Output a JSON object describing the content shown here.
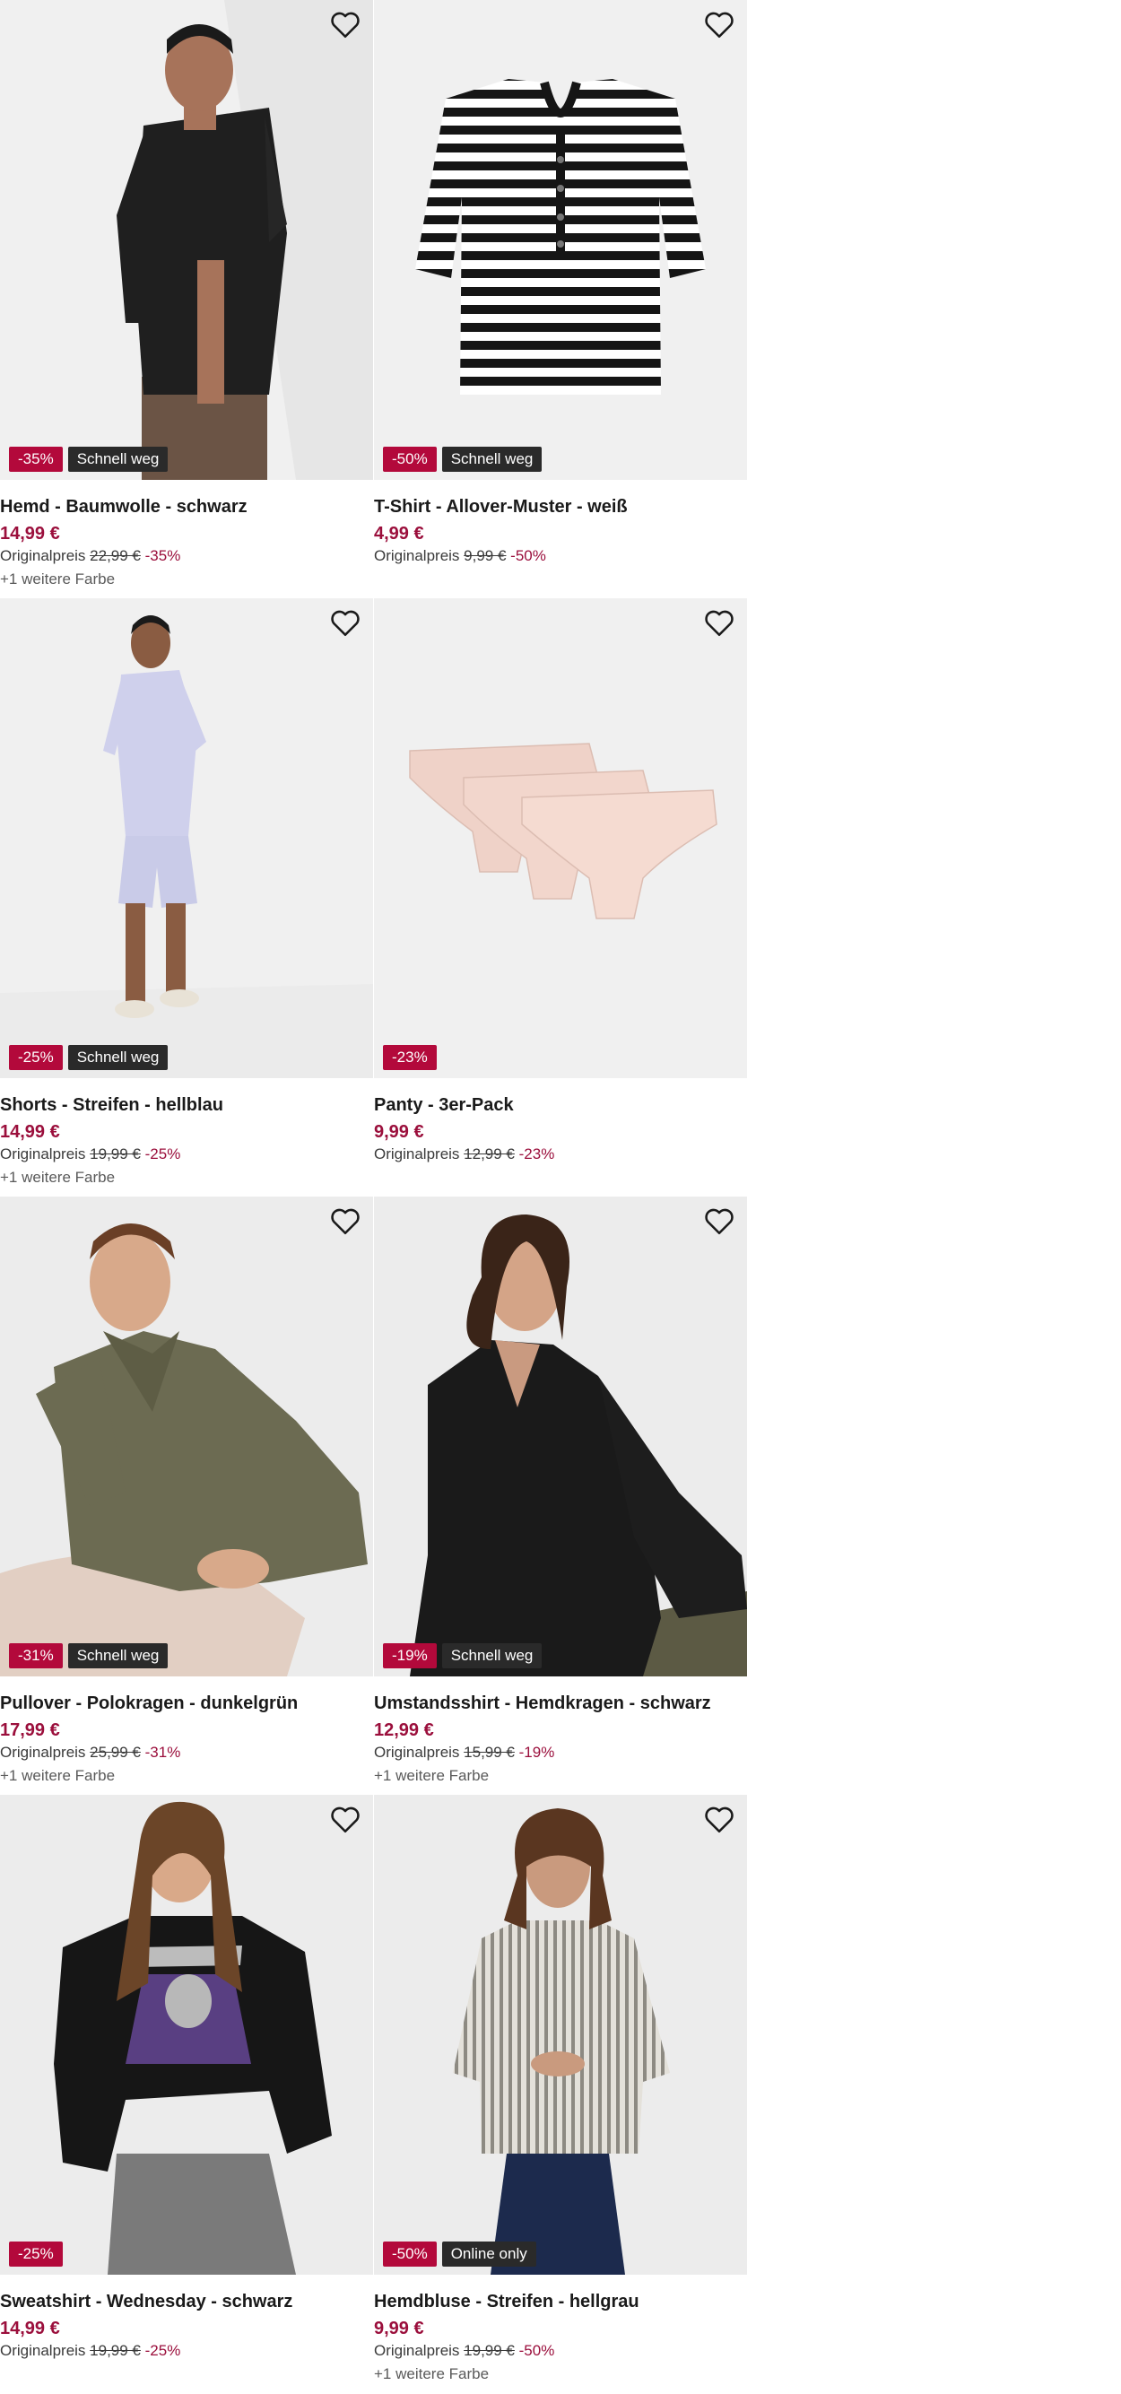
{
  "colors": {
    "price": "#9b0f3c",
    "discount_badge": "#b3093b",
    "tag_badge": "#2a2a2a",
    "image_bg": "#f0f0f0"
  },
  "products": [
    {
      "title": "Hemd - Baumwolle - schwarz",
      "price": "14,99 €",
      "original_label": "Originalpreis",
      "original_price": "22,99 €",
      "discount_text": "-35%",
      "badge_discount": "-35%",
      "badge_tag": "Schnell weg",
      "more_colors": "+1 weitere Farbe",
      "image": "man-black-shirt"
    },
    {
      "title": "T-Shirt - Allover-Muster - weiß",
      "price": "4,99 €",
      "original_label": "Originalpreis",
      "original_price": "9,99 €",
      "discount_text": "-50%",
      "badge_discount": "-50%",
      "badge_tag": "Schnell weg",
      "more_colors": "",
      "image": "striped-tshirt"
    },
    {
      "title": "Shorts - Streifen - hellblau",
      "price": "14,99 €",
      "original_label": "Originalpreis",
      "original_price": "19,99 €",
      "discount_text": "-25%",
      "badge_discount": "-25%",
      "badge_tag": "Schnell weg",
      "more_colors": "+1 weitere Farbe",
      "image": "man-light-blue-set"
    },
    {
      "title": "Panty - 3er-Pack",
      "price": "9,99 €",
      "original_label": "Originalpreis",
      "original_price": "12,99 €",
      "discount_text": "-23%",
      "badge_discount": "-23%",
      "badge_tag": "",
      "more_colors": "",
      "image": "pink-panties"
    },
    {
      "title": "Pullover - Polokragen - dunkelgrün",
      "price": "17,99 €",
      "original_label": "Originalpreis",
      "original_price": "25,99 €",
      "discount_text": "-31%",
      "badge_discount": "-31%",
      "badge_tag": "Schnell weg",
      "more_colors": "+1 weitere Farbe",
      "image": "man-green-pullover"
    },
    {
      "title": "Umstandsshirt - Hemdkragen - schwarz",
      "price": "12,99 €",
      "original_label": "Originalpreis",
      "original_price": "15,99 €",
      "discount_text": "-19%",
      "badge_discount": "-19%",
      "badge_tag": "Schnell weg",
      "more_colors": "+1 weitere Farbe",
      "image": "woman-black-shirt"
    },
    {
      "title": "Sweatshirt - Wednesday - schwarz",
      "price": "14,99 €",
      "original_label": "Originalpreis",
      "original_price": "19,99 €",
      "discount_text": "-25%",
      "badge_discount": "-25%",
      "badge_tag": "",
      "more_colors": "",
      "image": "girl-wednesday-sweatshirt"
    },
    {
      "title": "Hemdbluse - Streifen - hellgrau",
      "price": "9,99 €",
      "original_label": "Originalpreis",
      "original_price": "19,99 €",
      "discount_text": "-50%",
      "badge_discount": "-50%",
      "badge_tag": "Online only",
      "more_colors": "+1 weitere Farbe",
      "image": "woman-striped-blouse"
    }
  ]
}
